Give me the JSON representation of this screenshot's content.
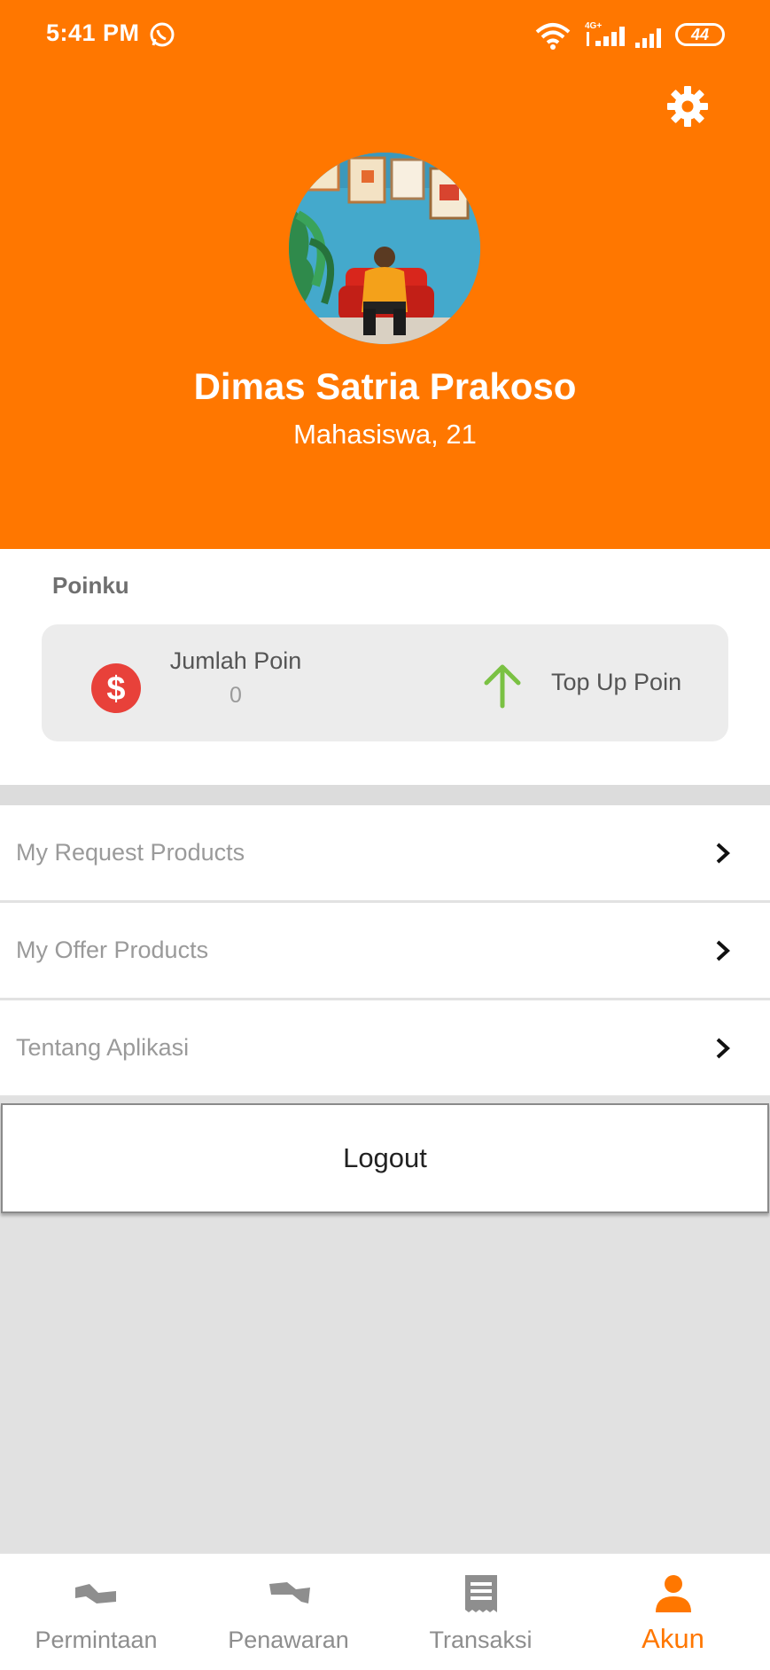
{
  "status_bar": {
    "time": "5:41 PM",
    "network": "4G+",
    "battery": "44",
    "icons": [
      "whatsapp-icon",
      "wifi-icon",
      "signal-icon",
      "battery-icon"
    ]
  },
  "header": {
    "settings_icon": "gear-icon",
    "profile": {
      "name": "Dimas Satria Prakoso",
      "subtitle": "Mahasiswa, 21"
    }
  },
  "poin": {
    "title": "Poinku",
    "jumlah_label": "Jumlah Poin",
    "jumlah_value": "0",
    "topup_label": "Top Up Poin"
  },
  "menu": [
    {
      "label": "My Request Products"
    },
    {
      "label": "My Offer Products"
    },
    {
      "label": "Tentang Aplikasi"
    }
  ],
  "logout_label": "Logout",
  "bottom_nav": [
    {
      "label": "Permintaan",
      "icon": "request-icon",
      "active": false
    },
    {
      "label": "Penawaran",
      "icon": "offer-icon",
      "active": false
    },
    {
      "label": "Transaksi",
      "icon": "receipt-icon",
      "active": false
    },
    {
      "label": "Akun",
      "icon": "person-icon",
      "active": true
    }
  ],
  "colors": {
    "primary": "#ff7700",
    "dollar": "#e8413a",
    "arrow": "#7ac143",
    "nav_inactive": "#8e8e8e"
  }
}
